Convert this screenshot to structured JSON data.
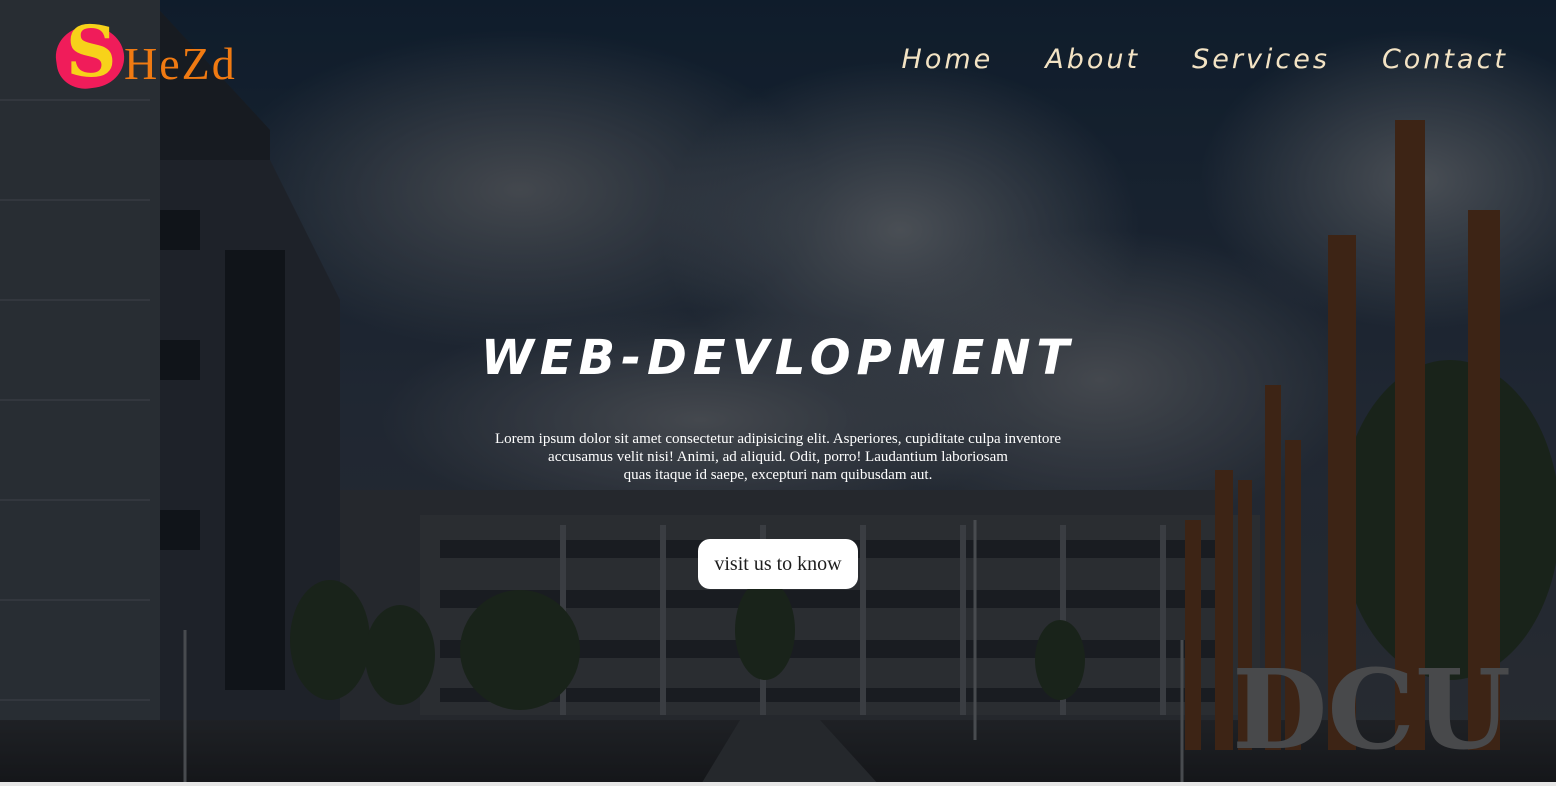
{
  "brand": {
    "logo_initial": "S",
    "logo_rest": "HeZd"
  },
  "nav": {
    "items": [
      {
        "label": "Home"
      },
      {
        "label": "About"
      },
      {
        "label": "Services"
      },
      {
        "label": "Contact"
      }
    ]
  },
  "hero": {
    "title": "WEB-DEVLOPMENT",
    "lead_line_1": "Lorem ipsum dolor sit amet consectetur adipisicing elit. Asperiores, cupiditate culpa inventore",
    "lead_line_2": "accusamus velit nisi! Animi, ad aliquid. Odit, porro! Laudantium laboriosam",
    "lead_line_3": "quas itaque id saepe, excepturi nam quibusdam aut.",
    "cta_label": "visit us to know",
    "sign_text": "DCU"
  },
  "colors": {
    "logo_blob": "#f01c5a",
    "logo_initial": "#f7d21a",
    "logo_rest": "#f07a12",
    "nav_text": "#f3e3c4",
    "title_text": "#ffffff",
    "cta_bg": "#ffffff"
  },
  "icons": {
    "logo": "brand-logo"
  }
}
